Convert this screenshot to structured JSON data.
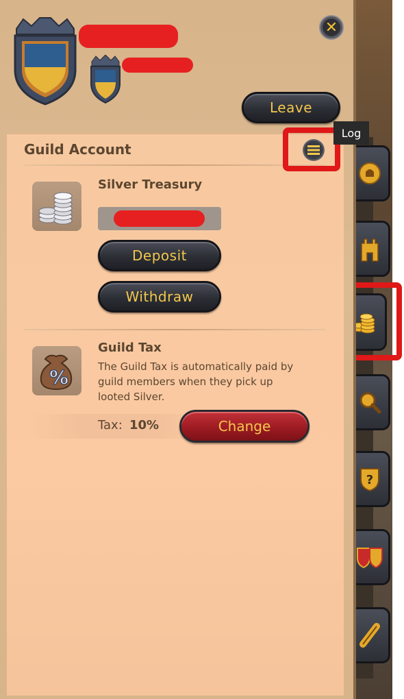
{
  "window": {
    "close_icon": "close-icon"
  },
  "header": {
    "leave_label": "Leave"
  },
  "tooltip": {
    "text": "Log"
  },
  "account": {
    "title": "Guild Account",
    "treasury": {
      "title": "Silver Treasury",
      "deposit_label": "Deposit",
      "withdraw_label": "Withdraw"
    },
    "tax": {
      "title": "Guild Tax",
      "description_line1": "The Guild Tax is automatically paid by",
      "description_line2": "guild members when they pick up",
      "description_line3": "looted Silver.",
      "label": "Tax:",
      "value": "10%",
      "change_label": "Change"
    }
  },
  "sidebar": {
    "items": [
      {
        "icon": "bell-icon"
      },
      {
        "icon": "tower-icon"
      },
      {
        "icon": "gold-coins-icon",
        "active": true
      },
      {
        "icon": "magnifier-icon"
      },
      {
        "icon": "question-shield-icon"
      },
      {
        "icon": "shields-icon"
      },
      {
        "icon": "scroll-icon"
      }
    ]
  },
  "colors": {
    "accent_gold": "#f2c84b",
    "text_brown": "#5b4630",
    "highlight_red": "#e01818",
    "redaction_red": "#e62020"
  }
}
